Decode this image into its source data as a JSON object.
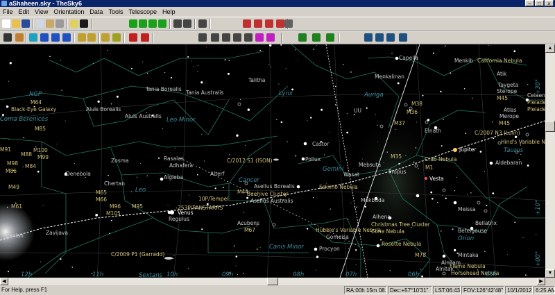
{
  "window": {
    "title": "aShaheen.sky - TheSky6"
  },
  "menu": [
    "File",
    "Edit",
    "View",
    "Orientation",
    "Data",
    "Tools",
    "Telescope",
    "Help"
  ],
  "status": {
    "help": "For Help, press F1",
    "ra": "RA:00h 15m 08.1s",
    "dec": "Dec:+57°10'31\"",
    "lst": "LST:06:43",
    "fov": "FOV:126°42'48\"",
    "date": "10/1/2012",
    "time": "6:25 AM"
  },
  "sky": {
    "colors": {
      "constellation_line": "#1f7a62",
      "ecliptic": "#d8d8d8",
      "meridian": "#d8d8d8",
      "grid": "#3a3a3a",
      "star": "#ffffff",
      "label": "#d2c07a",
      "cname": "#3e8e9c",
      "planet_moon": "#ffffff",
      "deep_sky": "#b4b4b4"
    },
    "labels": [
      {
        "id": "capella",
        "text": "Capella",
        "cls": "star"
      },
      {
        "id": "menkib",
        "text": "Menkib",
        "cls": "star"
      },
      {
        "id": "california",
        "text": "California Nebula",
        "cls": "dso"
      },
      {
        "id": "atik",
        "text": "Atik",
        "cls": "star"
      },
      {
        "id": "taygeta",
        "text": "Taygeta",
        "cls": "star"
      },
      {
        "id": "sterope",
        "text": "Sterope",
        "cls": "star"
      },
      {
        "id": "m45a",
        "text": "M45",
        "cls": "dso"
      },
      {
        "id": "celaeno",
        "text": "Celaeno",
        "cls": "star"
      },
      {
        "id": "pleiades1",
        "text": "Pleiades",
        "cls": "dso"
      },
      {
        "id": "pleiades2",
        "text": "Pleiades",
        "cls": "dso"
      },
      {
        "id": "atlas",
        "text": "Atlas",
        "cls": "star"
      },
      {
        "id": "merope",
        "text": "Merope",
        "cls": "star"
      },
      {
        "id": "m45b",
        "text": "M45",
        "cls": "dso"
      },
      {
        "id": "menkalinan",
        "text": "Menkalinan",
        "cls": "star"
      },
      {
        "id": "talitha",
        "text": "Talitha",
        "cls": "star"
      },
      {
        "id": "tania_b",
        "text": "Tania Borealis",
        "cls": "star"
      },
      {
        "id": "tania_a",
        "text": "Tania Australis",
        "cls": "star"
      },
      {
        "id": "lynx",
        "text": "Lynx",
        "cls": "con"
      },
      {
        "id": "auriga",
        "text": "Auriga",
        "cls": "con"
      },
      {
        "id": "ngp",
        "text": "NGP",
        "cls": "con"
      },
      {
        "id": "m64",
        "text": "M64",
        "cls": "dso"
      },
      {
        "id": "blackeye",
        "text": "Black-Eye Galaxy",
        "cls": "dso"
      },
      {
        "id": "coma",
        "text": "Coma Berenices",
        "cls": "con"
      },
      {
        "id": "aluls_b",
        "text": "Aluls Borealis",
        "cls": "star"
      },
      {
        "id": "aluls_a",
        "text": "Aluls Australis",
        "cls": "star"
      },
      {
        "id": "leominor",
        "text": "Leo Minor",
        "cls": "con"
      },
      {
        "id": "m38",
        "text": "M38",
        "cls": "dso"
      },
      {
        "id": "m36",
        "text": "M36",
        "cls": "dso"
      },
      {
        "id": "uu",
        "text": "UU",
        "cls": "star"
      },
      {
        "id": "m37",
        "text": "M37",
        "cls": "dso"
      },
      {
        "id": "elnath",
        "text": "Elnath",
        "cls": "star"
      },
      {
        "id": "lulin",
        "text": "C/2007 N3 (Lulin)",
        "cls": "dso"
      },
      {
        "id": "hinds",
        "text": "Hind's Variable Nebula",
        "cls": "dso"
      },
      {
        "id": "taurus",
        "text": "Taurus",
        "cls": "con"
      },
      {
        "id": "m85",
        "text": "M85",
        "cls": "dso"
      },
      {
        "id": "m91",
        "text": "M91",
        "cls": "dso"
      },
      {
        "id": "m100",
        "text": "M100",
        "cls": "dso"
      },
      {
        "id": "m88",
        "text": "M88",
        "cls": "dso"
      },
      {
        "id": "m99",
        "text": "M99",
        "cls": "dso"
      },
      {
        "id": "m98",
        "text": "M98",
        "cls": "dso"
      },
      {
        "id": "m84",
        "text": "M84",
        "cls": "dso"
      },
      {
        "id": "m86",
        "text": "M86",
        "cls": "dso"
      },
      {
        "id": "castor",
        "text": "Castor",
        "cls": "star"
      },
      {
        "id": "jupiter",
        "text": "Jupiter",
        "cls": "planet"
      },
      {
        "id": "m35",
        "text": "M35",
        "cls": "dso"
      },
      {
        "id": "crab",
        "text": "Crab Nebula",
        "cls": "dso"
      },
      {
        "id": "m1",
        "text": "M1",
        "cls": "dso"
      },
      {
        "id": "aldebaran",
        "text": "Aldebaran",
        "cls": "star"
      },
      {
        "id": "zosma",
        "text": "Zosma",
        "cls": "star"
      },
      {
        "id": "rasalas",
        "text": "Rasalas",
        "cls": "star"
      },
      {
        "id": "adhafera",
        "text": "Adhafera",
        "cls": "star"
      },
      {
        "id": "ison",
        "text": "C/2012 S1 (ISON)",
        "cls": "dso"
      },
      {
        "id": "pollux",
        "text": "Pollux",
        "cls": "star"
      },
      {
        "id": "gemini",
        "text": "Gemini",
        "cls": "con"
      },
      {
        "id": "mebsuta",
        "text": "Mebsuta",
        "cls": "star"
      },
      {
        "id": "propus",
        "text": "Propus",
        "cls": "star"
      },
      {
        "id": "vesta",
        "text": "Vesta",
        "cls": "planet"
      },
      {
        "id": "denebola",
        "text": "Denebola",
        "cls": "star"
      },
      {
        "id": "algieba",
        "text": "Algieba",
        "cls": "star"
      },
      {
        "id": "alterf",
        "text": "Alterf",
        "cls": "star"
      },
      {
        "id": "cancer",
        "text": "Cancer",
        "cls": "con"
      },
      {
        "id": "wasat",
        "text": "Wasat",
        "cls": "star"
      },
      {
        "id": "eskimo",
        "text": "Eskimo Nebula",
        "cls": "dso"
      },
      {
        "id": "m49",
        "text": "M49",
        "cls": "dso"
      },
      {
        "id": "chertan",
        "text": "Chertan",
        "cls": "star"
      },
      {
        "id": "m44",
        "text": "M44",
        "cls": "dso"
      },
      {
        "id": "asellus_b",
        "text": "Asellus Borealis",
        "cls": "star"
      },
      {
        "id": "beehive",
        "text": "Beehive Cluster",
        "cls": "dso"
      },
      {
        "id": "asellus_a",
        "text": "Asellus Australis",
        "cls": "star"
      },
      {
        "id": "tempel",
        "text": "10P/Tempel",
        "cls": "dso"
      },
      {
        "id": "leo",
        "text": "Leo",
        "cls": "con"
      },
      {
        "id": "m65",
        "text": "M65",
        "cls": "dso"
      },
      {
        "id": "m66",
        "text": "M66",
        "cls": "dso"
      },
      {
        "id": "m61",
        "text": "M61",
        "cls": "dso"
      },
      {
        "id": "m96",
        "text": "M96",
        "cls": "dso"
      },
      {
        "id": "m95",
        "text": "M95",
        "cls": "dso"
      },
      {
        "id": "m105",
        "text": "M105",
        "cls": "dso"
      },
      {
        "id": "venus",
        "text": "Venus",
        "cls": "planet"
      },
      {
        "id": "panstarrs",
        "text": "253P/PANSTARRS",
        "cls": "dso"
      },
      {
        "id": "regulus",
        "text": "Regulus",
        "cls": "star"
      },
      {
        "id": "mekbuda",
        "text": "Mekbuda",
        "cls": "star"
      },
      {
        "id": "alhena",
        "text": "Alhena",
        "cls": "star"
      },
      {
        "id": "meissa",
        "text": "Meissa",
        "cls": "star"
      },
      {
        "id": "bellatrix",
        "text": "Bellatrix",
        "cls": "star"
      },
      {
        "id": "acubens",
        "text": "Acubens",
        "cls": "star"
      },
      {
        "id": "m67",
        "text": "M67",
        "cls": "dso"
      },
      {
        "id": "hubble",
        "text": "Hubble's Variable Nebula",
        "cls": "dso"
      },
      {
        "id": "christmas",
        "text": "Christmas Tree Cluster",
        "cls": "dso"
      },
      {
        "id": "cone",
        "text": "Cone Nebula",
        "cls": "dso"
      },
      {
        "id": "betelgeuse",
        "text": "Betelgeuse",
        "cls": "star"
      },
      {
        "id": "orion",
        "text": "Orion",
        "cls": "con"
      },
      {
        "id": "zaniah",
        "text": "Zaniah",
        "cls": "star"
      },
      {
        "id": "zavijava",
        "text": "Zavijava",
        "cls": "star"
      },
      {
        "id": "gomeisa",
        "text": "Gomeisa",
        "cls": "star"
      },
      {
        "id": "canis_minor",
        "text": "Canis Minor",
        "cls": "con"
      },
      {
        "id": "procyon",
        "text": "Procyon",
        "cls": "star"
      },
      {
        "id": "rosette",
        "text": "Rosette Nebula",
        "cls": "dso"
      },
      {
        "id": "mintaka",
        "text": "Mintaka",
        "cls": "star"
      },
      {
        "id": "garradd",
        "text": "C/2009 P1 (Garradd)",
        "cls": "dso"
      },
      {
        "id": "m78",
        "text": "M78",
        "cls": "dso"
      },
      {
        "id": "alnilam",
        "text": "Alnilam",
        "cls": "star"
      },
      {
        "id": "alnitak",
        "text": "Alnitak",
        "cls": "star"
      },
      {
        "id": "flame",
        "text": "Flame Nebula",
        "cls": "dso"
      },
      {
        "id": "horsehead",
        "text": "Horsehead Nebula",
        "cls": "dso"
      },
      {
        "id": "sextans",
        "text": "Sextans",
        "cls": "con"
      }
    ],
    "grid_labels": [
      {
        "id": "ra12",
        "text": "12h"
      },
      {
        "id": "ra11",
        "text": "11h"
      },
      {
        "id": "ra10",
        "text": "10h"
      },
      {
        "id": "ra09",
        "text": "09h"
      },
      {
        "id": "ra08",
        "text": "08h"
      },
      {
        "id": "ra07",
        "text": "07h"
      },
      {
        "id": "ra06",
        "text": "06h"
      },
      {
        "id": "ra05",
        "text": "05h"
      },
      {
        "id": "dec30",
        "text": "+30°"
      },
      {
        "id": "dec10",
        "text": "+10°"
      },
      {
        "id": "dec0",
        "text": "+00°"
      }
    ]
  }
}
